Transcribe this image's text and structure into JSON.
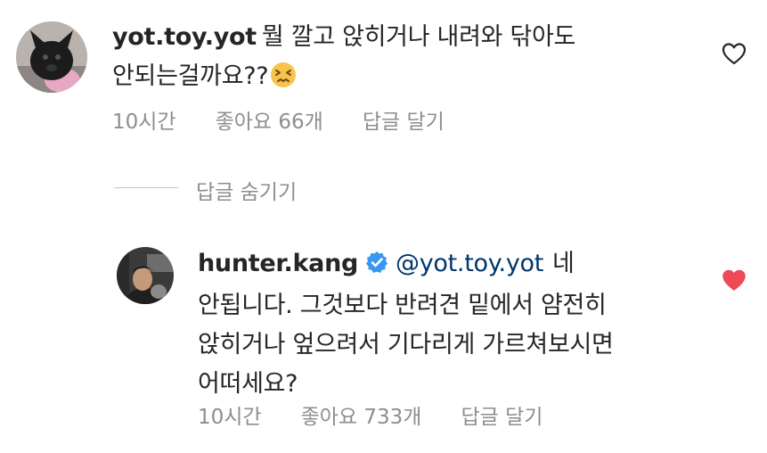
{
  "comment1": {
    "username": "yot.toy.yot",
    "text_line1": "뭘 깔고 앉히거나 내려와 닦아도",
    "text_line2": "안되는걸까요??",
    "emoji": "persevering-face-emoji",
    "time": "10시간",
    "likes": "좋아요 66개",
    "reply": "답글 달기",
    "liked": false
  },
  "hide_replies": {
    "label": "답글 숨기기"
  },
  "reply1": {
    "username": "hunter.kang",
    "verified": true,
    "mention": "@yot.toy.yot",
    "text_first": "네",
    "text_line2": "안됩니다. 그것보다 반려견 밑에서 얌전히",
    "text_line3": "앉히거나 엎으려서 기다리게 가르쳐보시면",
    "text_line4": "어떠세요?",
    "time": "10시간",
    "likes": "좋아요 733개",
    "reply": "답글 달기",
    "liked": true
  },
  "colors": {
    "text": "#262626",
    "meta": "#8e8e8e",
    "mention": "#00376b",
    "verified": "#3897f0",
    "heart_liked": "#ed4956"
  }
}
